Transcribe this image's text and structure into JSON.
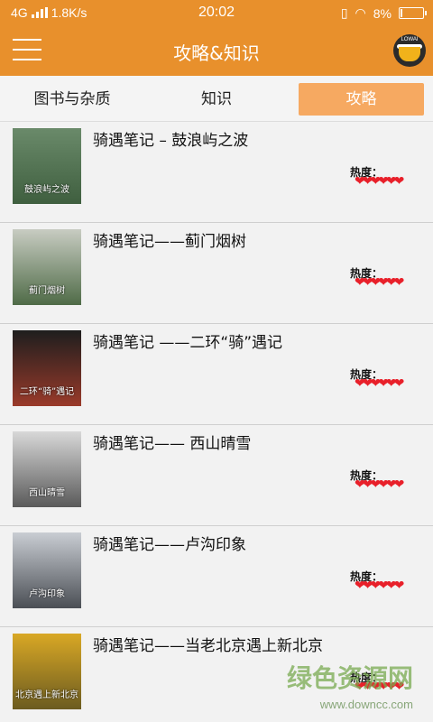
{
  "status_bar": {
    "network": "4G",
    "speed": "1.8K/s",
    "time": "20:02",
    "battery": "8%",
    "battery_level": 0.08
  },
  "app_bar": {
    "title": "攻略&知识",
    "avatar_text": "LOWAI"
  },
  "tabs": [
    {
      "label": "图书与杂质",
      "active": false
    },
    {
      "label": "知识",
      "active": false
    },
    {
      "label": "攻略",
      "active": true
    }
  ],
  "heat_label": "热度：",
  "items": [
    {
      "title": "骑遇笔记 – 鼓浪屿之波",
      "hearts": "❤❤❤❤❤❤",
      "thumb_text": "鼓浪屿之波",
      "thumb_colors": [
        "#6a8a6a",
        "#3f5f3f"
      ]
    },
    {
      "title": "骑遇笔记——蓟门烟树",
      "hearts": "❤❤❤❤❤❤",
      "thumb_text": "蓟门烟树",
      "thumb_colors": [
        "#c8ccc2",
        "#4f6b47"
      ]
    },
    {
      "title": "骑遇笔记 ——二环“骑”遇记",
      "hearts": "❤❤❤❤❤❤",
      "thumb_text": "二环“骑”遇记",
      "thumb_colors": [
        "#1e1e1e",
        "#9a3a2a"
      ]
    },
    {
      "title": "骑遇笔记—— 西山晴雪",
      "hearts": "❤❤❤❤❤❤",
      "thumb_text": "西山晴雪",
      "thumb_colors": [
        "#d8d8d8",
        "#5a5a5a"
      ]
    },
    {
      "title": "骑遇笔记——卢沟印象",
      "hearts": "❤❤❤❤❤❤",
      "thumb_text": "卢沟印象",
      "thumb_colors": [
        "#c9cdd3",
        "#4b4f55"
      ]
    },
    {
      "title": "骑遇笔记——当老北京遇上新北京",
      "hearts": "❤❤❤❤❤❤",
      "thumb_text": "北京遇上新北京",
      "thumb_colors": [
        "#d9a825",
        "#6b5b20"
      ]
    }
  ],
  "watermark": {
    "main": "绿色资源网",
    "url": "www.downcc.com"
  }
}
